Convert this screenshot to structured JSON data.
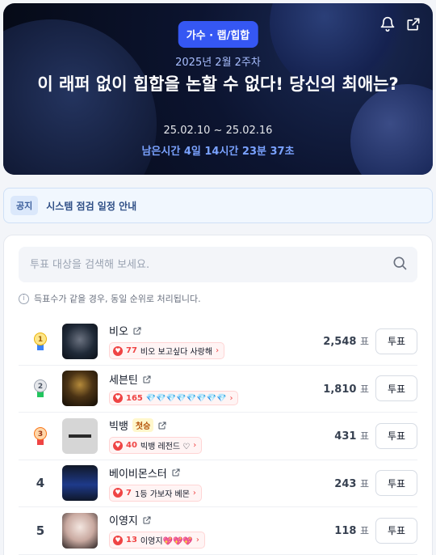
{
  "hero": {
    "category": "가수 · 랩/힙합",
    "week": "2025년 2월 2주차",
    "title": "이 래퍼 없이 힙합을 논할 수 없다! 당신의 최애는?",
    "dates": "25.02.10 ~ 25.02.16",
    "remaining": "남은시간 4일 14시간 23분 37초",
    "icons": [
      "bell-icon",
      "share-icon"
    ]
  },
  "notice": {
    "tag": "공지",
    "text": "시스템 점검 일정 안내"
  },
  "search": {
    "placeholder": "투표 대상을 검색해 보세요."
  },
  "info_text": "득표수가 같을 경우, 동일 순위로 처리됩니다.",
  "vote_unit": "표",
  "vote_label": "투표",
  "candidates": [
    {
      "rank": "1",
      "name": "비오",
      "badge": "",
      "cheer_count": "77",
      "cheer_text": "비오 보고싶다 사랑해",
      "votes": "2,548"
    },
    {
      "rank": "2",
      "name": "세븐틴",
      "badge": "",
      "cheer_count": "165",
      "cheer_text": "💎💎💎💎💎💎💎💎",
      "votes": "1,810"
    },
    {
      "rank": "3",
      "name": "빅뱅",
      "badge": "첫승",
      "cheer_count": "40",
      "cheer_text": "빅뱅 레전드 ♡",
      "votes": "431"
    },
    {
      "rank": "4",
      "name": "베이비몬스터",
      "badge": "",
      "cheer_count": "7",
      "cheer_text": "1등 가보자 베몬",
      "votes": "243"
    },
    {
      "rank": "5",
      "name": "이영지",
      "badge": "",
      "cheer_count": "13",
      "cheer_text": "이영지💖💖💖",
      "votes": "118"
    }
  ]
}
